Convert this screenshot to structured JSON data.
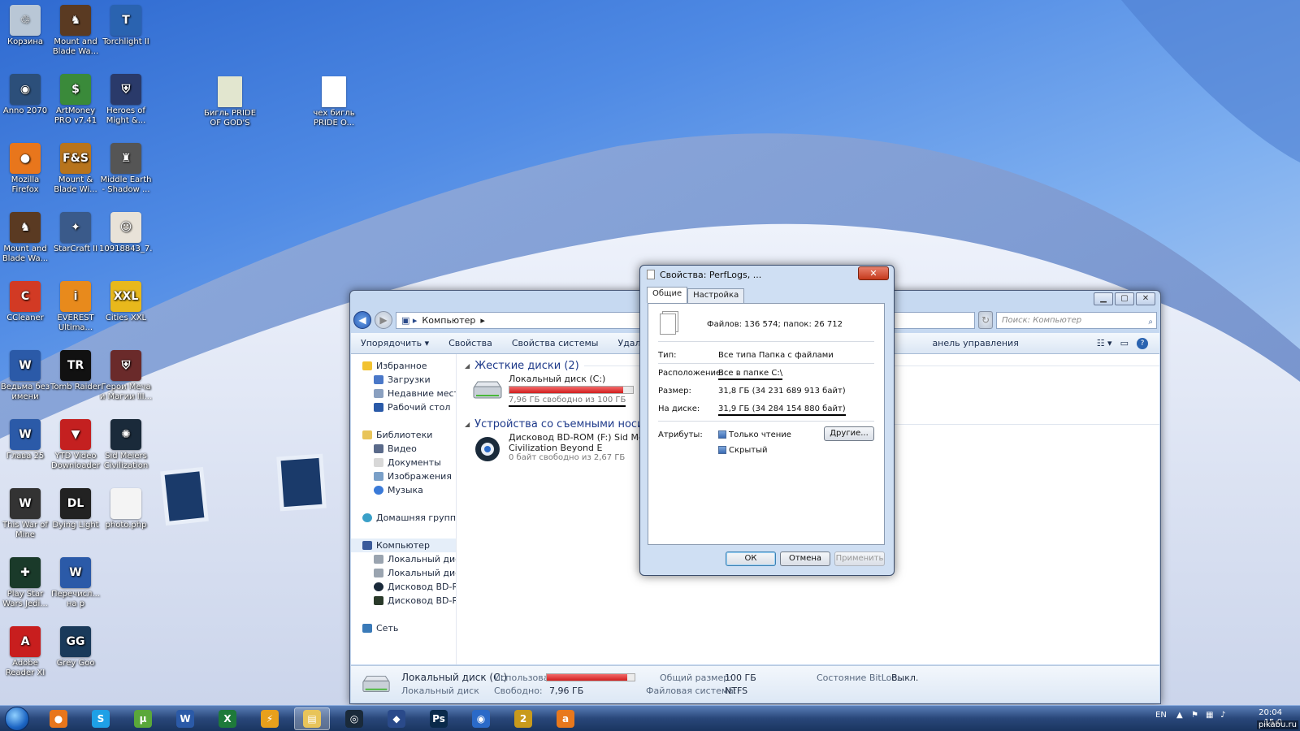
{
  "desktop": {
    "icons": [
      {
        "label": "Корзина",
        "icon": "recycle-bin-icon",
        "color": "#b9c7d6",
        "glyph": "♲"
      },
      {
        "label": "Mount and Blade Wa...",
        "icon": "mount-and-blade-icon",
        "color": "#5a3a22",
        "glyph": "♞"
      },
      {
        "label": "Torchlight II",
        "icon": "torchlight-icon",
        "color": "#2a63b0",
        "glyph": "T"
      },
      {
        "label": "Anno 2070",
        "icon": "anno-icon",
        "color": "#2c4f7a",
        "glyph": "◉"
      },
      {
        "label": "ArtMoney PRO v7.41",
        "icon": "artmoney-icon",
        "color": "#3a8a3a",
        "glyph": "$"
      },
      {
        "label": "Heroes of Might &...",
        "icon": "heroes-icon",
        "color": "#2a3a6a",
        "glyph": "⛨"
      },
      {
        "label": "Mozilla Firefox",
        "icon": "firefox-icon",
        "color": "#e8761c",
        "glyph": "●"
      },
      {
        "label": "Mount & Blade Wi...",
        "icon": "mount-blade-fs-icon",
        "color": "#b8741c",
        "glyph": "F&S"
      },
      {
        "label": "Middle Earth - Shadow ...",
        "icon": "middle-earth-icon",
        "color": "#555555",
        "glyph": "♜"
      },
      {
        "label": "Mount and Blade Wa...",
        "icon": "mount-and-blade-icon",
        "color": "#5a3a22",
        "glyph": "♞"
      },
      {
        "label": "StarCraft II",
        "icon": "starcraft-icon",
        "color": "#3a5a8a",
        "glyph": "✦"
      },
      {
        "label": "10918843_7...",
        "icon": "image-file-icon",
        "color": "#e8e2d8",
        "glyph": "☺"
      },
      {
        "label": "CCleaner",
        "icon": "ccleaner-icon",
        "color": "#d23a24",
        "glyph": "C"
      },
      {
        "label": "EVEREST Ultima...",
        "icon": "everest-icon",
        "color": "#e88a1c",
        "glyph": "i"
      },
      {
        "label": "Cities XXL",
        "icon": "cities-icon",
        "color": "#e8b81c",
        "glyph": "XXL"
      },
      {
        "label": "Ведьма без имени",
        "icon": "word-doc-icon",
        "color": "#2b5aa8",
        "glyph": "W"
      },
      {
        "label": "Tomb Raider",
        "icon": "tomb-raider-icon",
        "color": "#111111",
        "glyph": "TR"
      },
      {
        "label": "Герои Меча и Магии III...",
        "icon": "heroes3-icon",
        "color": "#6a2a2a",
        "glyph": "⛨"
      },
      {
        "label": "Глава 25",
        "icon": "word-doc-icon",
        "color": "#2b5aa8",
        "glyph": "W"
      },
      {
        "label": "YTD Video Downloader",
        "icon": "ytd-icon",
        "color": "#c42020",
        "glyph": "▼"
      },
      {
        "label": "Sid Meiers Civilization ...",
        "icon": "civilization-icon",
        "color": "#1a2a3a",
        "glyph": "✺"
      },
      {
        "label": "This War of Mine",
        "icon": "this-war-of-mine-icon",
        "color": "#333333",
        "glyph": "W"
      },
      {
        "label": "Dying Light",
        "icon": "dying-light-icon",
        "color": "#222222",
        "glyph": "DL"
      },
      {
        "label": "photo.php",
        "icon": "blank-file-icon",
        "color": "#f4f4f4",
        "glyph": ""
      },
      {
        "label": "Play Star Wars Jedi...",
        "icon": "star-wars-icon",
        "color": "#1a3a2a",
        "glyph": "✚"
      },
      {
        "label": "Перечисл... на р",
        "icon": "word-doc-icon",
        "color": "#2b5aa8",
        "glyph": "W"
      },
      {
        "label": "Adobe Reader XI",
        "icon": "adobe-reader-icon",
        "color": "#c81e1e",
        "glyph": "A"
      },
      {
        "label": "Grey Goo",
        "icon": "grey-goo-icon",
        "color": "#1a3a5a",
        "glyph": "GG"
      }
    ],
    "file_icons": [
      {
        "label": "Бигль PRIDE OF GOD'S LUI",
        "icon": "document-image-icon"
      },
      {
        "label": "чех бигль PRIDE O...",
        "icon": "blank-document-icon"
      }
    ]
  },
  "explorer": {
    "address": "Компьютер",
    "search_placeholder": "Поиск: Компьютер",
    "commands": [
      "Упорядочить ▾",
      "Свойства",
      "Свойства системы",
      "Удалить или"
    ],
    "commands_right": "анель управления",
    "nav": {
      "favorites": "Избранное",
      "fav_items": [
        "Загрузки",
        "Недавние места",
        "Рабочий стол"
      ],
      "libraries": "Библиотеки",
      "lib_items": [
        "Видео",
        "Документы",
        "Изображения",
        "Музыка"
      ],
      "homegroup": "Домашняя группа",
      "computer": "Компьютер",
      "comp_items": [
        "Локальный диск (C",
        "Локальный диск (D",
        "Дисковод BD-ROM",
        "Дисковод BD-ROM"
      ],
      "network": "Сеть"
    },
    "groups": {
      "hdd": "Жесткие диски (2)",
      "removable": "Устройства со съемными носител"
    },
    "drive_c": {
      "name": "Локальный диск (C:)",
      "free": "7,96 ГБ свободно из 100 ГБ",
      "used_fraction": 0.92
    },
    "drive_f": {
      "name": "Дисковод BD-ROM (F:) Sid Meiers",
      "name2": "Civilization Beyond E",
      "free": "0 байт свободно из 2,67 ГБ"
    },
    "details": {
      "name": "Локальный диск (C:)",
      "type": "Локальный диск",
      "used_label": "Использовано:",
      "free_label": "Свободно:",
      "free_value": "7,96 ГБ",
      "total_label": "Общий размер:",
      "total_value": "100 ГБ",
      "fs_label": "Файловая система:",
      "fs_value": "NTFS",
      "bitlocker_label": "Состояние BitLoc...",
      "bitlocker_value": "Выкл.",
      "used_fraction": 0.92
    }
  },
  "properties": {
    "title": "Свойства: PerfLogs, ...",
    "tabs": [
      "Общие",
      "Настройка"
    ],
    "summary": "Файлов: 136 574; папок: 26 712",
    "rows": [
      {
        "k": "Тип:",
        "v": "Все типа Папка с файлами"
      },
      {
        "k": "Расположение:",
        "v": "Все в папке C:\\"
      },
      {
        "k": "Размер:",
        "v": "31,8 ГБ (34 231 689 913 байт)"
      },
      {
        "k": "На диске:",
        "v": "31,9 ГБ (34 284 154 880 байт)"
      }
    ],
    "attributes_label": "Атрибуты:",
    "readonly": "Только чтение",
    "hidden": "Скрытый",
    "other_button": "Другие...",
    "ok": "ОК",
    "cancel": "Отмена",
    "apply": "Применить"
  },
  "taskbar": {
    "apps": [
      {
        "icon": "firefox-icon",
        "color": "#e8761c",
        "glyph": "●"
      },
      {
        "icon": "skype-icon",
        "color": "#1ea0e6",
        "glyph": "S"
      },
      {
        "icon": "utorrent-icon",
        "color": "#5aa83a",
        "glyph": "µ"
      },
      {
        "icon": "word-icon",
        "color": "#2b5aa8",
        "glyph": "W"
      },
      {
        "icon": "excel-icon",
        "color": "#1e7a3a",
        "glyph": "X"
      },
      {
        "icon": "media-player-icon",
        "color": "#e8a01c",
        "glyph": "⚡"
      },
      {
        "icon": "explorer-icon",
        "color": "#e8c45a",
        "glyph": "▤"
      },
      {
        "icon": "steam-icon",
        "color": "#1a2a3a",
        "glyph": "◎"
      },
      {
        "icon": "game-icon",
        "color": "#2a4a8a",
        "glyph": "◆"
      },
      {
        "icon": "photoshop-icon",
        "color": "#0a2a4a",
        "glyph": "Ps"
      },
      {
        "icon": "google-earth-icon",
        "color": "#2a6ac8",
        "glyph": "◉"
      },
      {
        "icon": "game2-icon",
        "color": "#c89a1c",
        "glyph": "2"
      },
      {
        "icon": "avast-icon",
        "color": "#e8781c",
        "glyph": "a"
      }
    ],
    "lang": "EN",
    "time": "20:04",
    "date": "15.0",
    "watermark": "pikabu.ru"
  },
  "colors": {
    "accent": "#2a63b0",
    "disk_bar": "#d11e1e"
  }
}
